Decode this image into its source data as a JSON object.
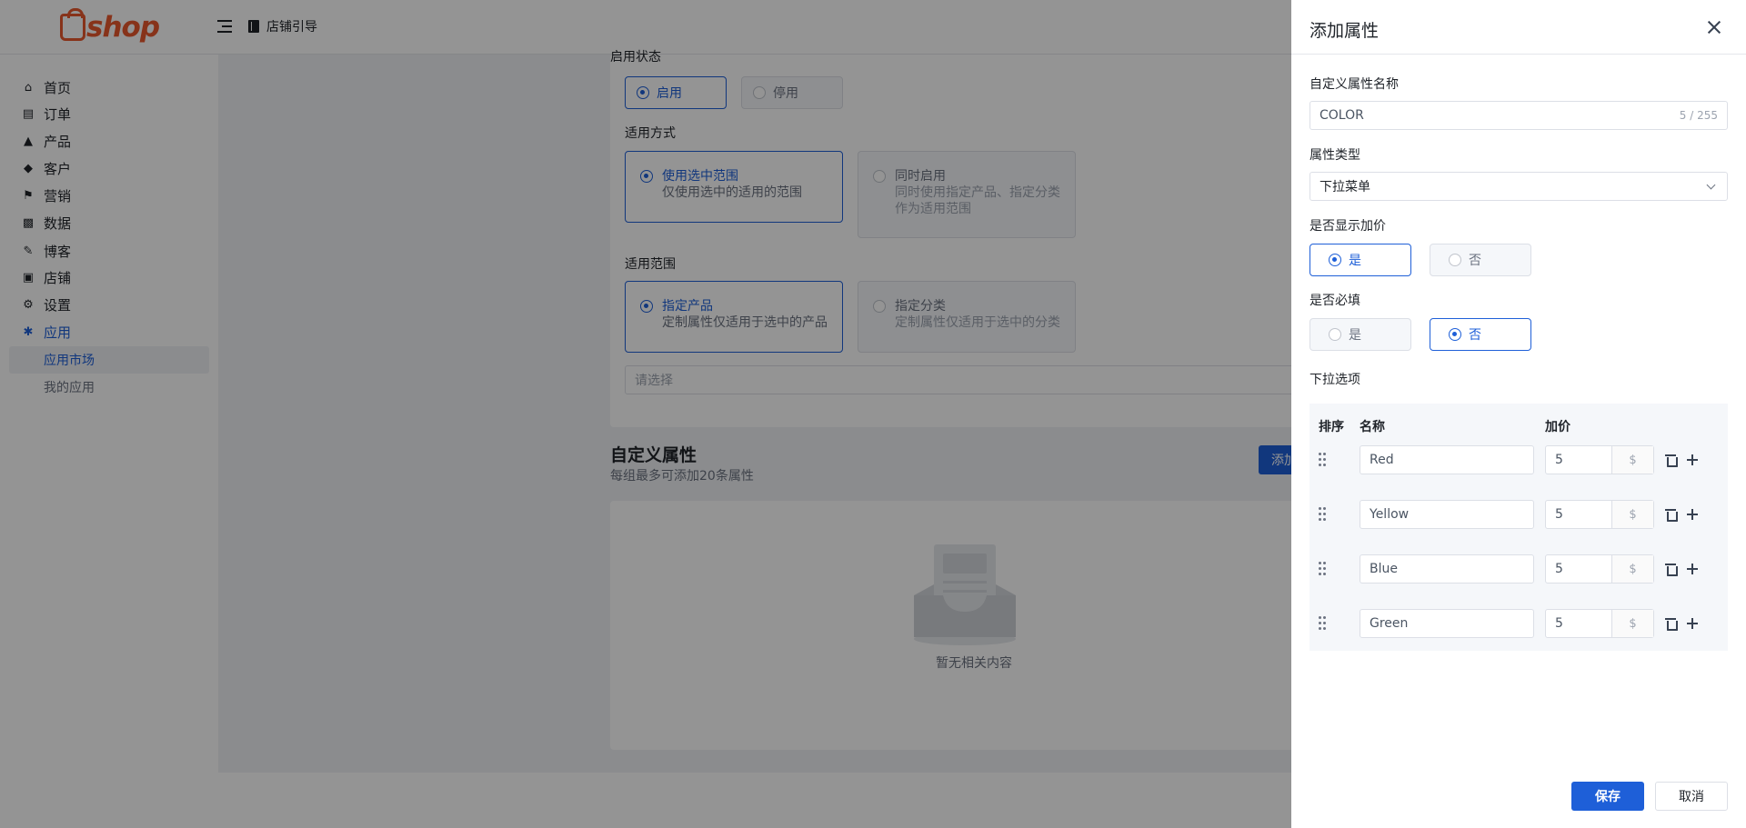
{
  "header": {
    "logo_text": "shop",
    "logo_mark": "2c",
    "guide_label": "店铺引导"
  },
  "sidebar": {
    "items": [
      {
        "label": "首页",
        "icon": "home-icon"
      },
      {
        "label": "订单",
        "icon": "order-icon"
      },
      {
        "label": "产品",
        "icon": "bag-icon"
      },
      {
        "label": "客户",
        "icon": "diamond-icon"
      },
      {
        "label": "营销",
        "icon": "tag-icon"
      },
      {
        "label": "数据",
        "icon": "bar-chart-icon"
      },
      {
        "label": "博客",
        "icon": "blog-icon"
      },
      {
        "label": "店铺",
        "icon": "store-icon"
      },
      {
        "label": "设置",
        "icon": "gear-icon"
      },
      {
        "label": "应用",
        "icon": "puzzle-icon"
      }
    ],
    "sub_items": [
      {
        "label": "应用市场"
      },
      {
        "label": "我的应用"
      }
    ],
    "active_color": "#1e5fd8"
  },
  "background_form": {
    "status_label": "启用状态",
    "status_options": [
      "启用",
      "停用"
    ],
    "mode_label": "适用方式",
    "mode_options": [
      {
        "title": "使用选中范围",
        "desc": "仅使用选中的适用的范围"
      },
      {
        "title": "同时启用",
        "desc": "同时使用指定产品、指定分类作为适用范围"
      }
    ],
    "scope_label": "适用范围",
    "scope_options": [
      {
        "title": "指定产品",
        "desc": "定制属性仅适用于选中的产品"
      },
      {
        "title": "指定分类",
        "desc": "定制属性仅适用于选中的分类"
      }
    ],
    "select_placeholder": "请选择",
    "custom_title": "自定义属性",
    "custom_subtitle": "每组最多可添加20条属性",
    "add_button": "添加",
    "empty_text": "暂无相关内容"
  },
  "drawer": {
    "title": "添加属性",
    "name_label": "自定义属性名称",
    "name_value": "COLOR",
    "name_counter": "5 / 255",
    "type_label": "属性类型",
    "type_value": "下拉菜单",
    "show_price_label": "是否显示加价",
    "show_price_options": [
      "是",
      "否"
    ],
    "show_price_selected": "是",
    "required_label": "是否必填",
    "required_options": [
      "是",
      "否"
    ],
    "required_selected": "否",
    "options_label": "下拉选项",
    "columns": {
      "order": "排序",
      "name": "名称",
      "price": "加价"
    },
    "rows": [
      {
        "name": "Red",
        "price": "5",
        "unit": "$"
      },
      {
        "name": "Yellow",
        "price": "5",
        "unit": "$"
      },
      {
        "name": "Blue",
        "price": "5",
        "unit": "$"
      },
      {
        "name": "Green",
        "price": "5",
        "unit": "$"
      }
    ],
    "save_label": "保存",
    "cancel_label": "取消"
  },
  "colors": {
    "brand": "#e8582d",
    "primary": "#1e5fd8",
    "overlay": "rgba(0,0,0,0.42)"
  }
}
